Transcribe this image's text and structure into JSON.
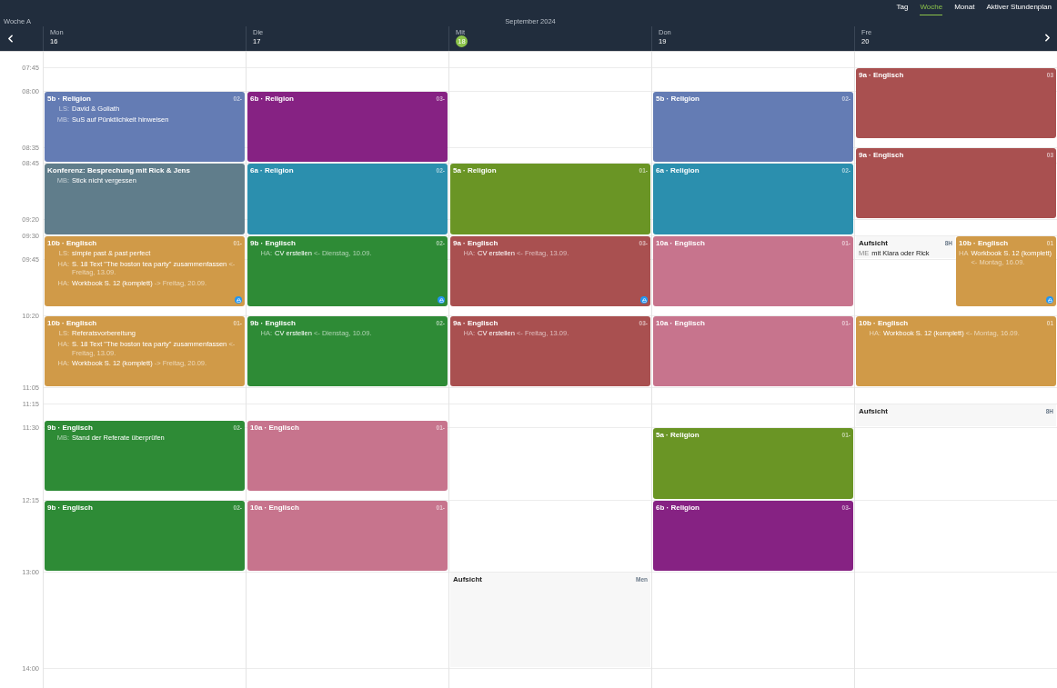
{
  "week_label": "Woche A",
  "month_label": "September 2024",
  "view_tabs": [
    {
      "label": "Tag",
      "selected": false
    },
    {
      "label": "Woche",
      "selected": true
    },
    {
      "label": "Monat",
      "selected": false
    },
    {
      "label": "Aktiver Stundenplan",
      "selected": false
    }
  ],
  "time_slots": [
    "07:45",
    "08:00",
    "08:35",
    "08:45",
    "09:20",
    "09:30",
    "09:45",
    "10:20",
    "11:05",
    "11:15",
    "11:30",
    "12:15",
    "13:00",
    "14:00"
  ],
  "days": [
    {
      "name": "Mon",
      "date": "16",
      "today": false,
      "events": [
        {
          "kind": "lesson",
          "title": "5b · Religion",
          "code": "02-",
          "color": "#647cb4",
          "locked": false,
          "notes": [
            {
              "label": "LS:",
              "text": "David & Goliath"
            },
            {
              "label": "MB:",
              "text": "SuS auf Pünktlichkeit hinweisen"
            }
          ]
        },
        {
          "kind": "lesson",
          "title": "Konferenz: Besprechung mit Rick & Jens",
          "color": "#607d8b",
          "locked": false,
          "notes": [
            {
              "label": "MB:",
              "text": "Stick nicht vergessen"
            }
          ]
        },
        {
          "kind": "lesson",
          "title": "10b · Englisch",
          "code": "01-",
          "color": "#d09a48",
          "locked": true,
          "notes": [
            {
              "label": "LS:",
              "text": "simple past & past perfect"
            },
            {
              "label": "HA:",
              "text": "S. 18 Text \"The boston tea party\" zusammenfassen",
              "due": "<- Freitag, 13.09."
            },
            {
              "label": "HA:",
              "text": "Workbook S. 12 (komplett)",
              "due": "-> Freitag, 20.09."
            }
          ]
        },
        {
          "kind": "lesson",
          "title": "10b · Englisch",
          "code": "01-",
          "color": "#d09a48",
          "locked": false,
          "notes": [
            {
              "label": "LS:",
              "text": "Referatsvorbereitung"
            },
            {
              "label": "HA:",
              "text": "S. 18 Text \"The boston tea party\" zusammenfassen",
              "due": "<- Freitag, 13.09."
            },
            {
              "label": "HA:",
              "text": "Workbook S. 12 (komplett)",
              "due": "-> Freitag, 20.09."
            }
          ]
        },
        {
          "kind": "lesson",
          "title": "9b · Englisch",
          "code": "02-",
          "color": "#2e8b36",
          "locked": false,
          "notes": [
            {
              "label": "MB:",
              "text": "Stand der Referate überprüfen"
            }
          ]
        },
        {
          "kind": "lesson",
          "title": "9b · Englisch",
          "code": "02-",
          "color": "#2e8b36",
          "locked": false
        }
      ]
    },
    {
      "name": "Die",
      "date": "17",
      "today": false,
      "events": [
        {
          "kind": "lesson",
          "title": "6b · Religion",
          "code": "03-",
          "color": "#862283",
          "locked": false
        },
        {
          "kind": "lesson",
          "title": "6a · Religion",
          "code": "02-",
          "color": "#2b8fae",
          "locked": false
        },
        {
          "kind": "lesson",
          "title": "9b · Englisch",
          "code": "02-",
          "color": "#2e8b36",
          "locked": true,
          "notes": [
            {
              "label": "HA:",
              "text": "CV erstellen",
              "due": "<- Dienstag, 10.09."
            }
          ]
        },
        {
          "kind": "lesson",
          "title": "9b · Englisch",
          "code": "02-",
          "color": "#2e8b36",
          "locked": false,
          "notes": [
            {
              "label": "HA:",
              "text": "CV erstellen",
              "due": "<- Dienstag, 10.09."
            }
          ]
        },
        {
          "kind": "lesson",
          "title": "10a · Englisch",
          "code": "01-",
          "color": "#c7748d",
          "locked": false
        },
        {
          "kind": "lesson",
          "title": "10a · Englisch",
          "code": "01-",
          "color": "#c7748d",
          "locked": false
        }
      ]
    },
    {
      "name": "Mit",
      "date": "18",
      "today": true,
      "events": [
        {
          "kind": "lesson",
          "title": "5a · Religion",
          "code": "01-",
          "color": "#6a9525",
          "locked": false
        },
        {
          "kind": "lesson",
          "title": "9a · Englisch",
          "code": "03-",
          "color": "#a95050",
          "locked": true,
          "notes": [
            {
              "label": "HA:",
              "text": "CV erstellen",
              "due": "<- Freitag, 13.09."
            }
          ]
        },
        {
          "kind": "lesson",
          "title": "9a · Englisch",
          "code": "03-",
          "color": "#a95050",
          "locked": false,
          "notes": [
            {
              "label": "HA:",
              "text": "CV erstellen",
              "due": "<- Freitag, 13.09."
            }
          ]
        },
        {
          "kind": "duty",
          "title": "Aufsicht",
          "code": "Men"
        }
      ]
    },
    {
      "name": "Don",
      "date": "19",
      "today": false,
      "events": [
        {
          "kind": "lesson",
          "title": "5b · Religion",
          "code": "02-",
          "color": "#647cb4",
          "locked": false
        },
        {
          "kind": "lesson",
          "title": "6a · Religion",
          "code": "02-",
          "color": "#2b8fae",
          "locked": false
        },
        {
          "kind": "lesson",
          "title": "10a · Englisch",
          "code": "01-",
          "color": "#c7748d",
          "locked": false
        },
        {
          "kind": "lesson",
          "title": "10a · Englisch",
          "code": "01-",
          "color": "#c7748d",
          "locked": false
        },
        {
          "kind": "lesson",
          "title": "5a · Religion",
          "code": "01-",
          "color": "#6a9525",
          "locked": false
        },
        {
          "kind": "lesson",
          "title": "6b · Religion",
          "code": "03-",
          "color": "#862283",
          "locked": false
        }
      ]
    },
    {
      "name": "Fre",
      "date": "20",
      "today": false,
      "events": [
        {
          "kind": "lesson",
          "title": "9a · Englisch",
          "code": "03",
          "color": "#a95050",
          "locked": false
        },
        {
          "kind": "lesson",
          "title": "9a · Englisch",
          "code": "03",
          "color": "#a95050",
          "locked": false
        },
        {
          "kind": "duty",
          "title": "Aufsicht",
          "code": "8H",
          "notes": [
            {
              "label": "ME",
              "text": "mit Klara oder Rick"
            }
          ]
        },
        {
          "kind": "lesson",
          "title": "10b · Englisch",
          "code": "01",
          "color": "#d09a48",
          "locked": true,
          "notes": [
            {
              "label": "HA",
              "text": "Workbook S. 12 (komplett)",
              "due": "<- Montag, 16.09."
            }
          ]
        },
        {
          "kind": "lesson",
          "title": "10b · Englisch",
          "code": "01",
          "color": "#d09a48",
          "locked": false,
          "notes": [
            {
              "label": "HA:",
              "text": "Workbook S. 12 (komplett)",
              "due": "<- Montag, 16.09."
            }
          ]
        },
        {
          "kind": "duty",
          "title": "Aufsicht",
          "code": "8H"
        }
      ]
    }
  ]
}
